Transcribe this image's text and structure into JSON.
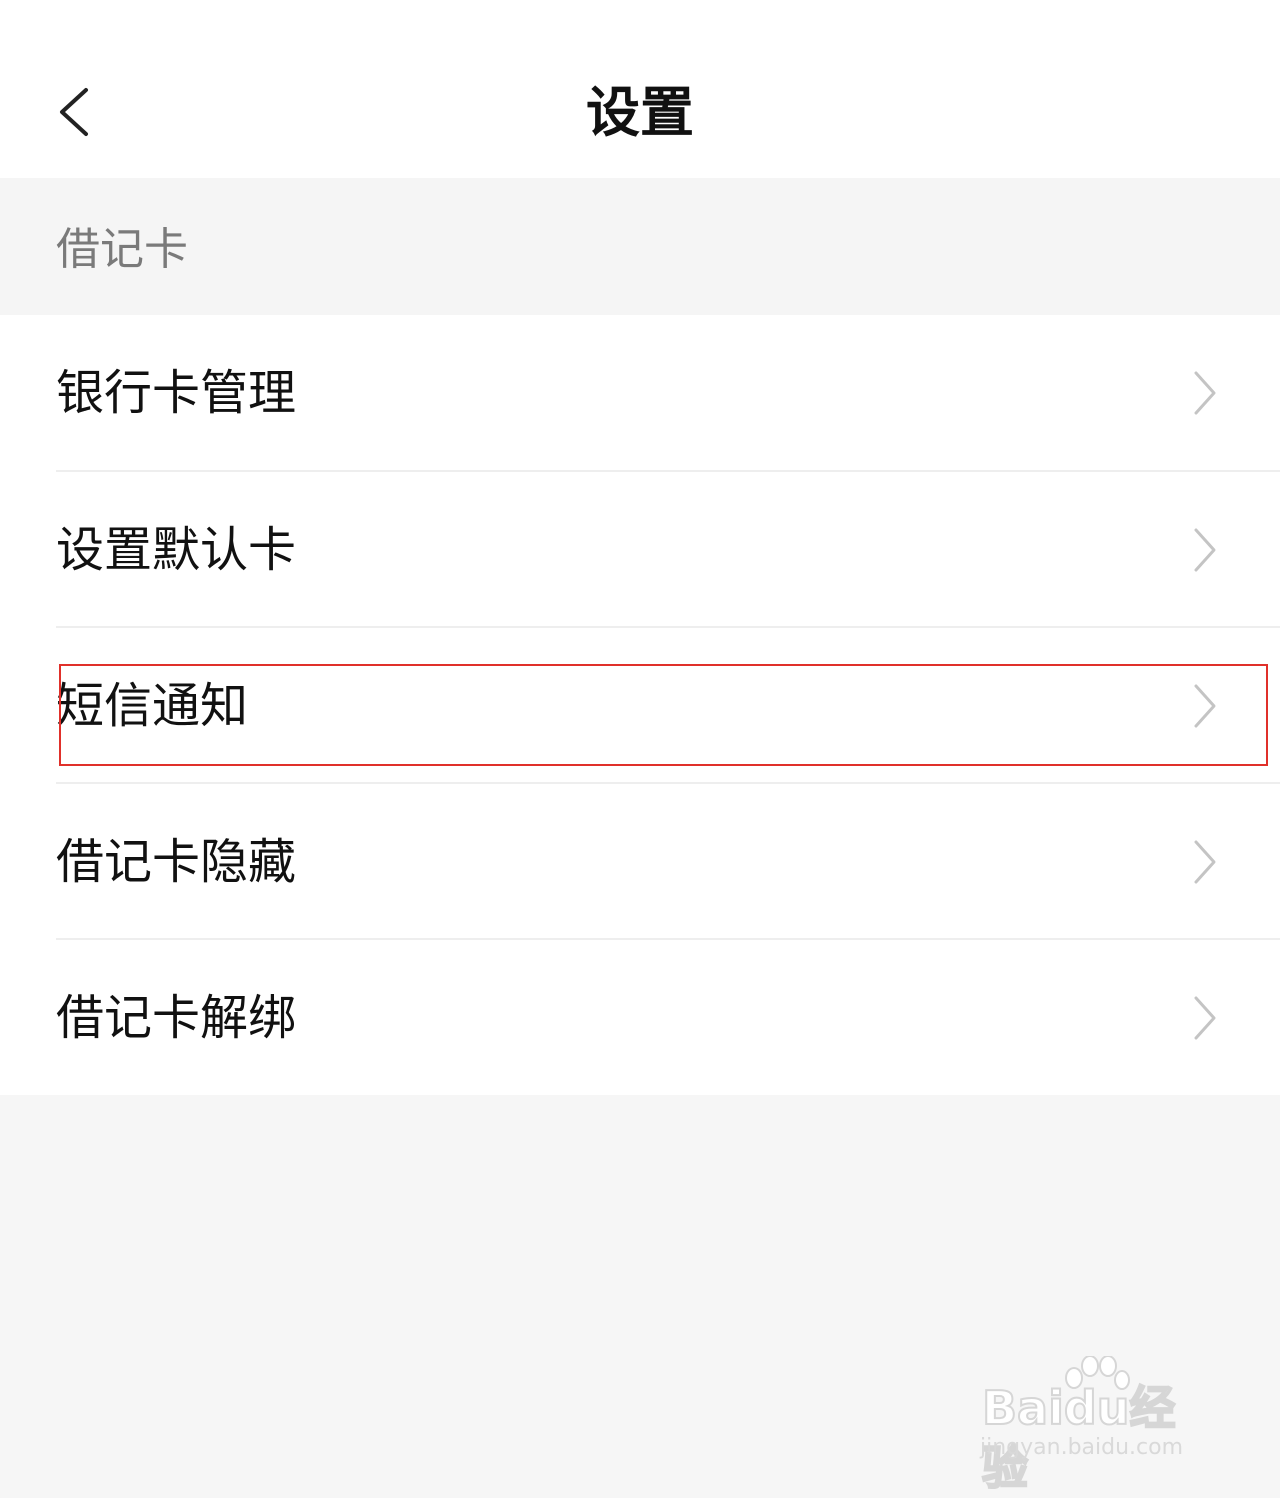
{
  "header": {
    "title": "设置",
    "back_icon": "chevron-left-icon"
  },
  "section": {
    "label": "借记卡"
  },
  "list": {
    "items": [
      {
        "label": "银行卡管理",
        "icon": "chevron-right-icon"
      },
      {
        "label": "设置默认卡",
        "icon": "chevron-right-icon"
      },
      {
        "label": "短信通知",
        "icon": "chevron-right-icon",
        "highlighted": true
      },
      {
        "label": "借记卡隐藏",
        "icon": "chevron-right-icon"
      },
      {
        "label": "借记卡解绑",
        "icon": "chevron-right-icon"
      }
    ]
  },
  "watermark": {
    "brand": "Baidu经验",
    "url": "jingyan.baidu.com"
  },
  "colors": {
    "highlight_border": "#e0302a",
    "page_background": "#f6f6f6",
    "text_primary": "#111111",
    "text_secondary": "#7a7a7a"
  }
}
